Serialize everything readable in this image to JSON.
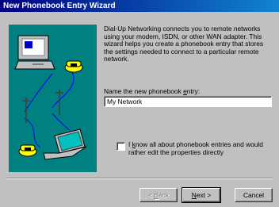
{
  "window": {
    "title": "New Phonebook Entry Wizard"
  },
  "main": {
    "description": "Dial-Up Networking connects you to remote networks using your modem, ISDN, or other WAN adapter.  This wizard helps you create a phonebook entry that stores the settings needed to connect to a particular remote network.",
    "name_label": "Name the new phonebook entry:",
    "name_value": "My Network",
    "checkbox_label": "I know all about phonebook entries and would rather edit the properties directly",
    "checkbox_checked": false
  },
  "buttons": {
    "back": "< Back",
    "next": "Next >",
    "cancel": "Cancel"
  },
  "colors": {
    "titlebar": "#000080",
    "face": "#c0c0c0",
    "illustration_bg": "#008080"
  },
  "icons": [
    "computer-icon",
    "telephone-icon",
    "laptop-icon",
    "telephone-pole-icon"
  ]
}
